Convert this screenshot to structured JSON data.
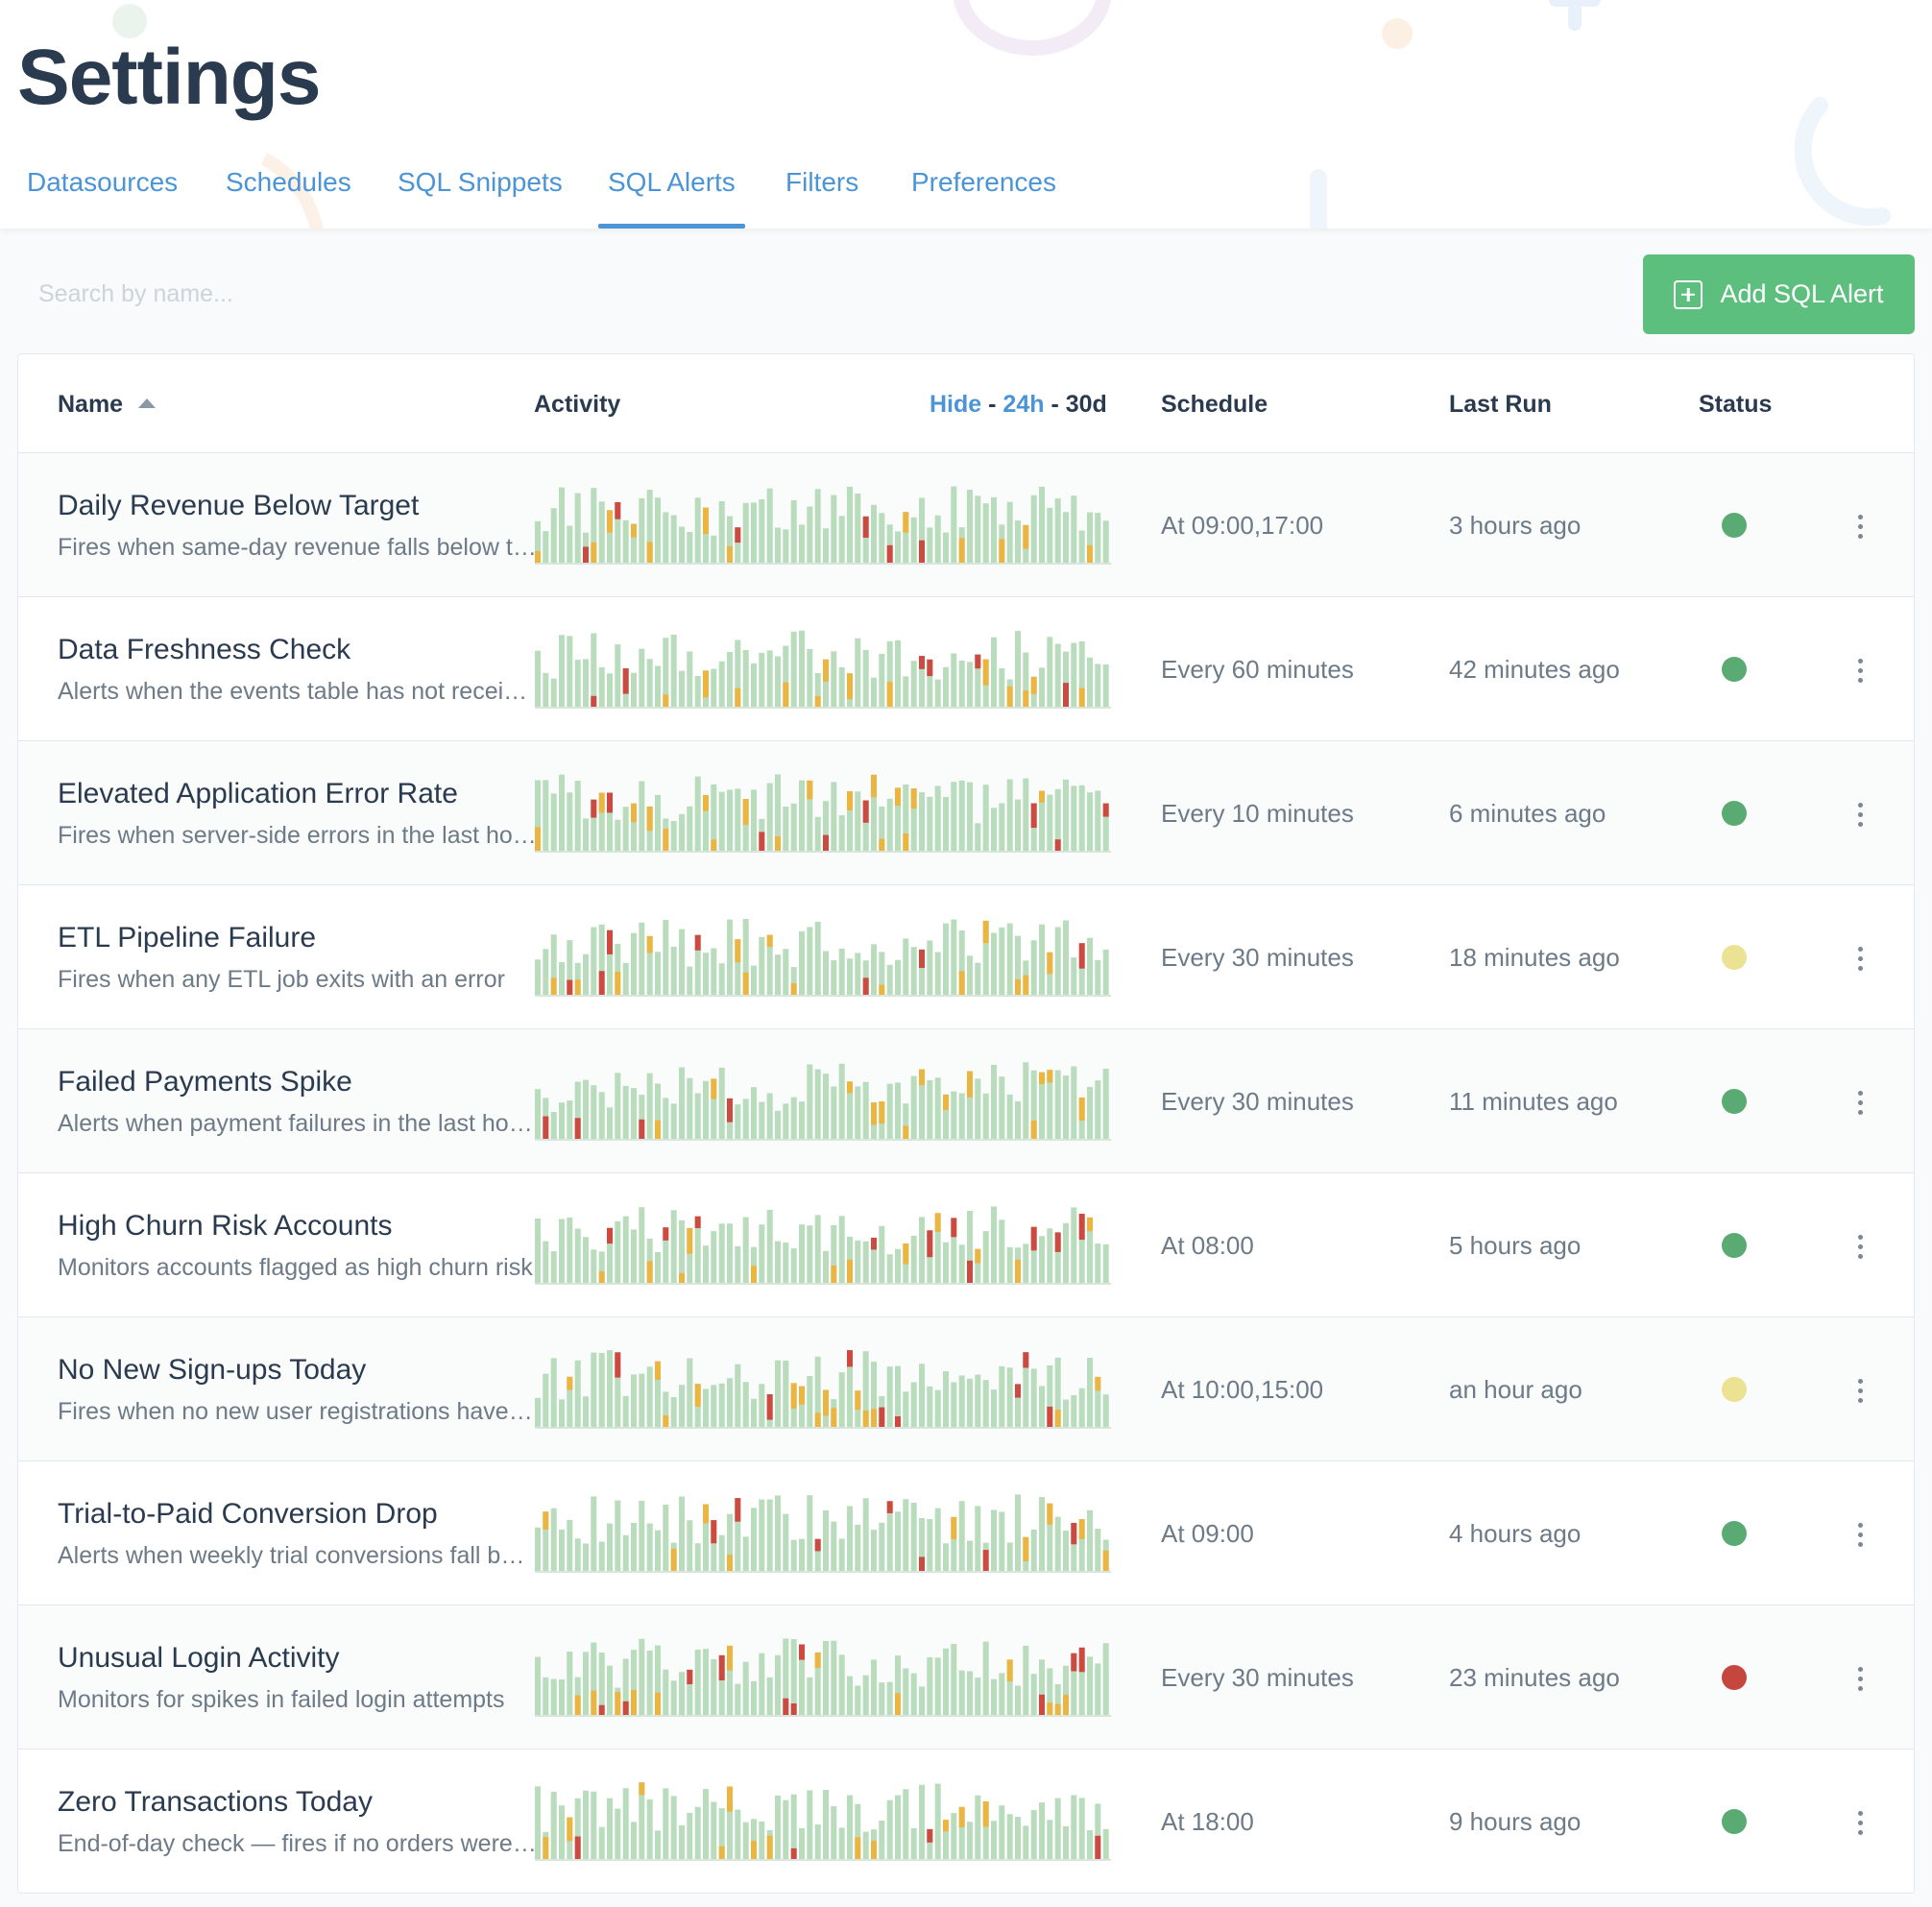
{
  "page": {
    "title": "Settings"
  },
  "tabs": [
    {
      "label": "Datasources",
      "active": false
    },
    {
      "label": "Schedules",
      "active": false
    },
    {
      "label": "SQL Snippets",
      "active": false
    },
    {
      "label": "SQL Alerts",
      "active": true
    },
    {
      "label": "Filters",
      "active": false
    },
    {
      "label": "Preferences",
      "active": false
    }
  ],
  "search": {
    "placeholder": "Search by name...",
    "value": ""
  },
  "add_button": {
    "label": "Add SQL Alert",
    "icon": "plus-square-icon"
  },
  "table": {
    "columns": {
      "name": "Name",
      "activity": "Activity",
      "schedule": "Schedule",
      "last_run": "Last Run",
      "status": "Status"
    },
    "sort": {
      "column": "name",
      "direction": "ascending",
      "icon": "sort-up-icon"
    },
    "activity_range": {
      "hide": "Hide",
      "sep": "-",
      "r24h": "24h",
      "r30d": "30d",
      "selected": "30d"
    },
    "rows": [
      {
        "name": "Daily Revenue Below Target",
        "description": "Fires when same-day revenue falls below target",
        "schedule": "At 09:00,17:00",
        "last_run": "3 hours ago",
        "status": "green"
      },
      {
        "name": "Data Freshness Check",
        "description": "Alerts when the events table has not received new rows",
        "schedule": "Every 60 minutes",
        "last_run": "42 minutes ago",
        "status": "green"
      },
      {
        "name": "Elevated Application Error Rate",
        "description": "Fires when server-side errors in the last hour exceed threshold",
        "schedule": "Every 10 minutes",
        "last_run": "6 minutes ago",
        "status": "green"
      },
      {
        "name": "ETL Pipeline Failure",
        "description": "Fires when any ETL job exits with an error",
        "schedule": "Every 30 minutes",
        "last_run": "18 minutes ago",
        "status": "yellow"
      },
      {
        "name": "Failed Payments Spike",
        "description": "Alerts when payment failures in the last hour spike",
        "schedule": "Every 30 minutes",
        "last_run": "11 minutes ago",
        "status": "green"
      },
      {
        "name": "High Churn Risk Accounts",
        "description": "Monitors accounts flagged as high churn risk",
        "schedule": "At 08:00",
        "last_run": "5 hours ago",
        "status": "green"
      },
      {
        "name": "No New Sign-ups Today",
        "description": "Fires when no new user registrations have occurred",
        "schedule": "At 10:00,15:00",
        "last_run": "an hour ago",
        "status": "yellow"
      },
      {
        "name": "Trial-to-Paid Conversion Drop",
        "description": "Alerts when weekly trial conversions fall below baseline",
        "schedule": "At 09:00",
        "last_run": "4 hours ago",
        "status": "green"
      },
      {
        "name": "Unusual Login Activity",
        "description": "Monitors for spikes in failed login attempts",
        "schedule": "Every 30 minutes",
        "last_run": "23 minutes ago",
        "status": "red"
      },
      {
        "name": "Zero Transactions Today",
        "description": "End-of-day check — fires if no orders were placed",
        "schedule": "At 18:00",
        "last_run": "9 hours ago",
        "status": "green"
      }
    ]
  },
  "colors": {
    "accent": "#4b94d6",
    "add_button": "#5cbf7e",
    "status_green": "#5aab73",
    "status_yellow": "#ece293",
    "status_red": "#c5463d",
    "bar_ok": "#b9dcbd",
    "bar_warn": "#eab641",
    "bar_fail": "#cc4a40"
  }
}
